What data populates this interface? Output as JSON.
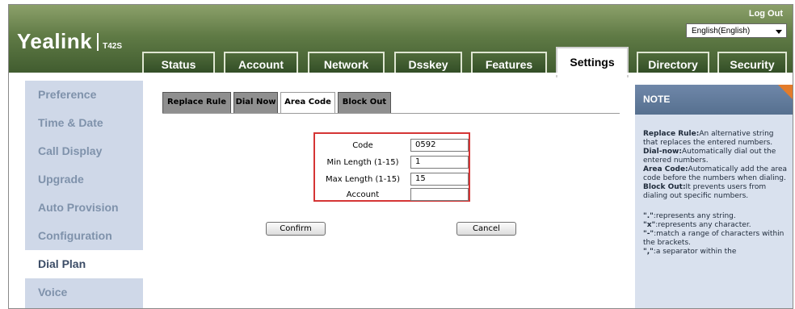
{
  "header": {
    "brand_name": "Yealink",
    "model": "T42S",
    "logout_label": "Log Out",
    "language": "English(English)"
  },
  "tabs": [
    {
      "label": "Status"
    },
    {
      "label": "Account"
    },
    {
      "label": "Network"
    },
    {
      "label": "Dsskey"
    },
    {
      "label": "Features"
    },
    {
      "label": "Settings",
      "active": true
    },
    {
      "label": "Directory"
    },
    {
      "label": "Security"
    }
  ],
  "sidebar": {
    "items": [
      {
        "label": "Preference"
      },
      {
        "label": "Time & Date"
      },
      {
        "label": "Call Display"
      },
      {
        "label": "Upgrade"
      },
      {
        "label": "Auto Provision"
      },
      {
        "label": "Configuration"
      },
      {
        "label": "Dial Plan",
        "active": true
      },
      {
        "label": "Voice"
      }
    ]
  },
  "subtabs": [
    {
      "label": "Replace Rule"
    },
    {
      "label": "Dial Now"
    },
    {
      "label": "Area Code",
      "active": true
    },
    {
      "label": "Block Out"
    }
  ],
  "form": {
    "code": {
      "label": "Code",
      "value": "0592"
    },
    "min_length": {
      "label": "Min Length (1-15)",
      "value": "1"
    },
    "max_length": {
      "label": "Max Length (1-15)",
      "value": "15"
    },
    "account": {
      "label": "Account",
      "value": ""
    },
    "confirm_label": "Confirm",
    "cancel_label": "Cancel"
  },
  "note": {
    "title": "NOTE",
    "entries": [
      {
        "term": "Replace Rule:",
        "text": "An alternative string that replaces the entered numbers."
      },
      {
        "term": "Dial-now:",
        "text": "Automatically dial out the entered numbers."
      },
      {
        "term": "Area Code:",
        "text": "Automatically add the area code before the numbers when dialing."
      },
      {
        "term": "Block Out:",
        "text": "It prevents users from dialing out specific numbers."
      }
    ],
    "symbols": [
      {
        "term": "\".\"",
        "text": ":represents any string."
      },
      {
        "term": "\"x\"",
        "text": ":represents any character."
      },
      {
        "term": "\"-\"",
        "text": ":match a range of characters within the brackets."
      },
      {
        "term": "\",\"",
        "text": ":a separator within the"
      }
    ]
  },
  "colors": {
    "header_green": "#5f7a45",
    "sidebar_bg": "#cfd8e8",
    "note_bg": "#d9e1ee",
    "note_head": "#6f87a9",
    "highlight_red": "#d53535",
    "note_corner": "#e37c2b"
  }
}
